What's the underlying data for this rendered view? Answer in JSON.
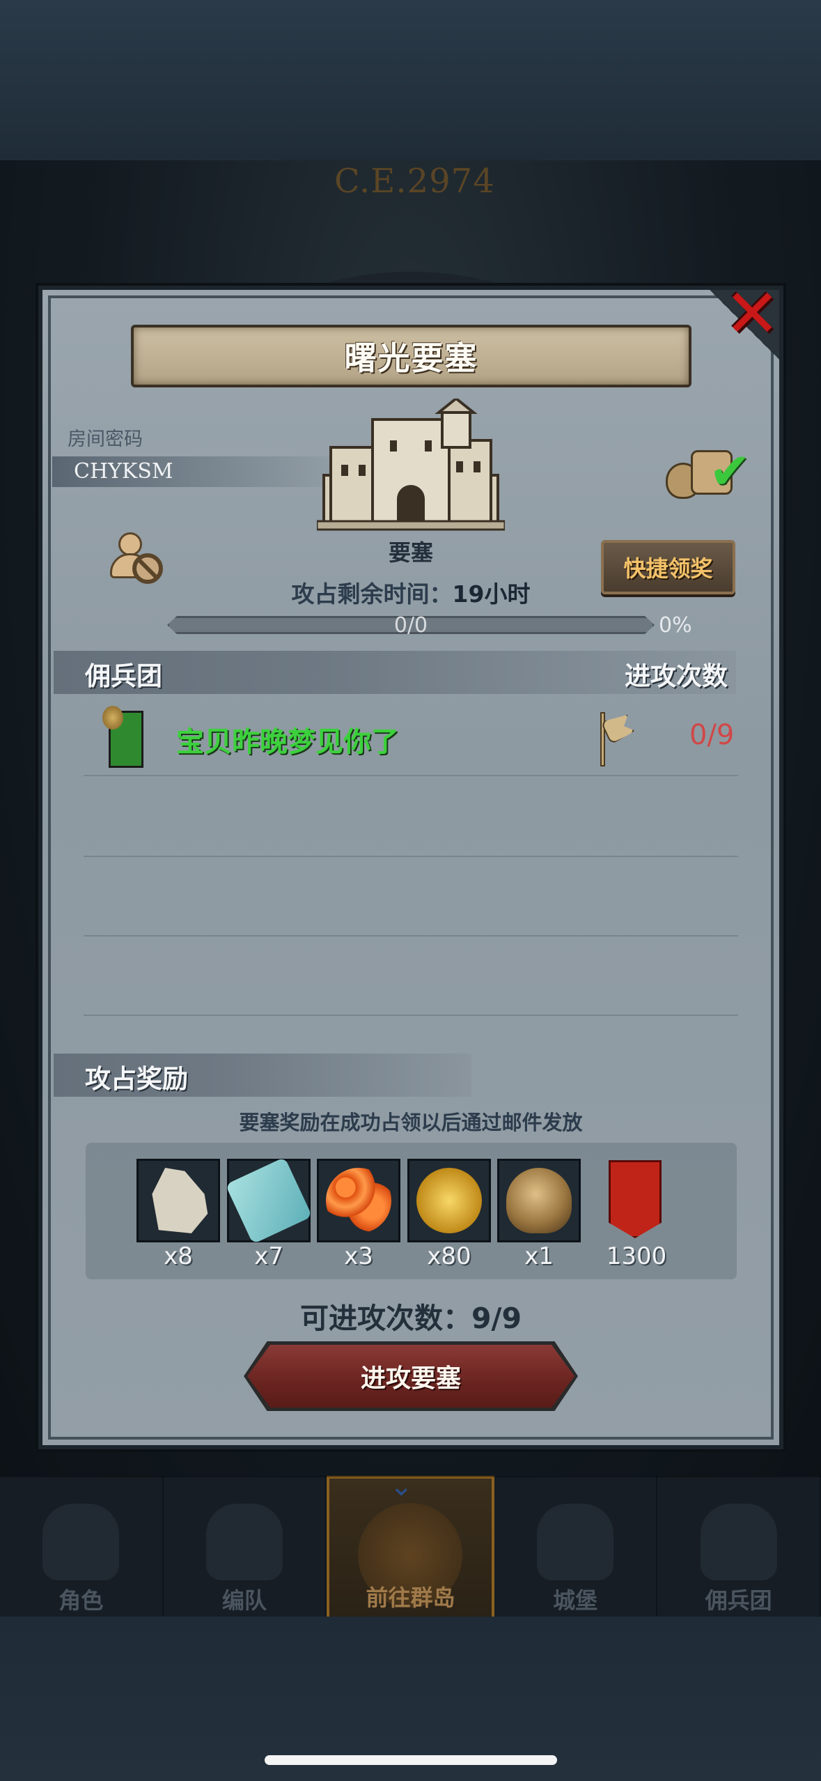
{
  "background": {
    "era_label": "C.E.2974"
  },
  "navbar": {
    "items": [
      {
        "label": "角色",
        "active": false
      },
      {
        "label": "编队",
        "active": false
      },
      {
        "label": "前往群岛",
        "active": true
      },
      {
        "label": "城堡",
        "active": false
      },
      {
        "label": "佣兵团",
        "active": false
      }
    ]
  },
  "panel": {
    "title": "曙光要塞",
    "room_label": "房间密码",
    "room_code": "CHYKSM",
    "building_name": "要塞",
    "quick_claim_label": "快捷领奖",
    "timer_label": "攻占剩余时间：",
    "timer_value": "19小时",
    "progress_count": "0/0",
    "progress_percent": "0%",
    "progress_fraction": 0,
    "mercenary_header": "佣兵团",
    "attack_count_header": "进攻次数",
    "guilds": [
      {
        "name": "宝贝昨晚梦见你了",
        "attacks": "0/9"
      }
    ],
    "rewards_header": "攻占奖励",
    "reward_note": "要塞奖励在成功占领以后通过邮件发放",
    "rewards": [
      {
        "icon": "horse-icon",
        "qty": "x8"
      },
      {
        "icon": "cloth-icon",
        "qty": "x7"
      },
      {
        "icon": "caviar-icon",
        "qty": "x3"
      },
      {
        "icon": "gold-coin-icon",
        "qty": "x80"
      },
      {
        "icon": "helmet-icon",
        "qty": "x1"
      },
      {
        "icon": "guild-banner-icon",
        "qty": "1300"
      }
    ],
    "attempts_label": "可进攻次数：9/9",
    "attack_button_label": "进攻要塞"
  },
  "colors": {
    "guild_name": "#3cd13c",
    "attack_count": "#d04848",
    "quick_claim_text": "#f3c26a",
    "close": "#c81818"
  }
}
